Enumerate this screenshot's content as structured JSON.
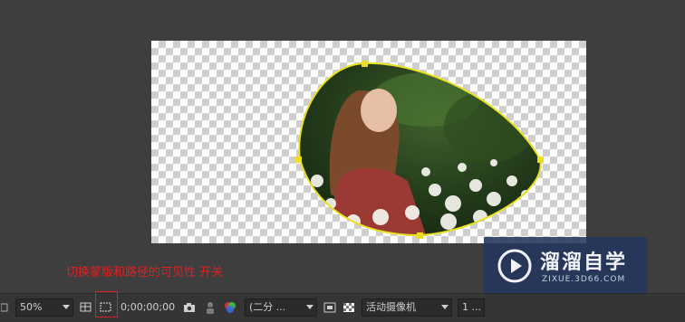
{
  "annotation": {
    "text": "切换蒙版和路径的可见性 开关"
  },
  "statusbar": {
    "zoom": "50%",
    "timecode": "0;00;00;00",
    "resolution": "(二分 ...",
    "camera": "活动摄像机",
    "views": "1 ..."
  },
  "watermark": {
    "title": "溜溜自学",
    "url": "ZIXUE.3D66.COM"
  },
  "colors": {
    "mask_path": "#e8e020",
    "highlight": "#e02020",
    "annotation": "#e02020"
  },
  "icons": [
    "grid-icon",
    "mask-visibility-icon",
    "camera-icon",
    "person-icon",
    "color-channels-icon",
    "fast-preview-icon",
    "transparency-grid-icon",
    "play-logo-icon"
  ]
}
